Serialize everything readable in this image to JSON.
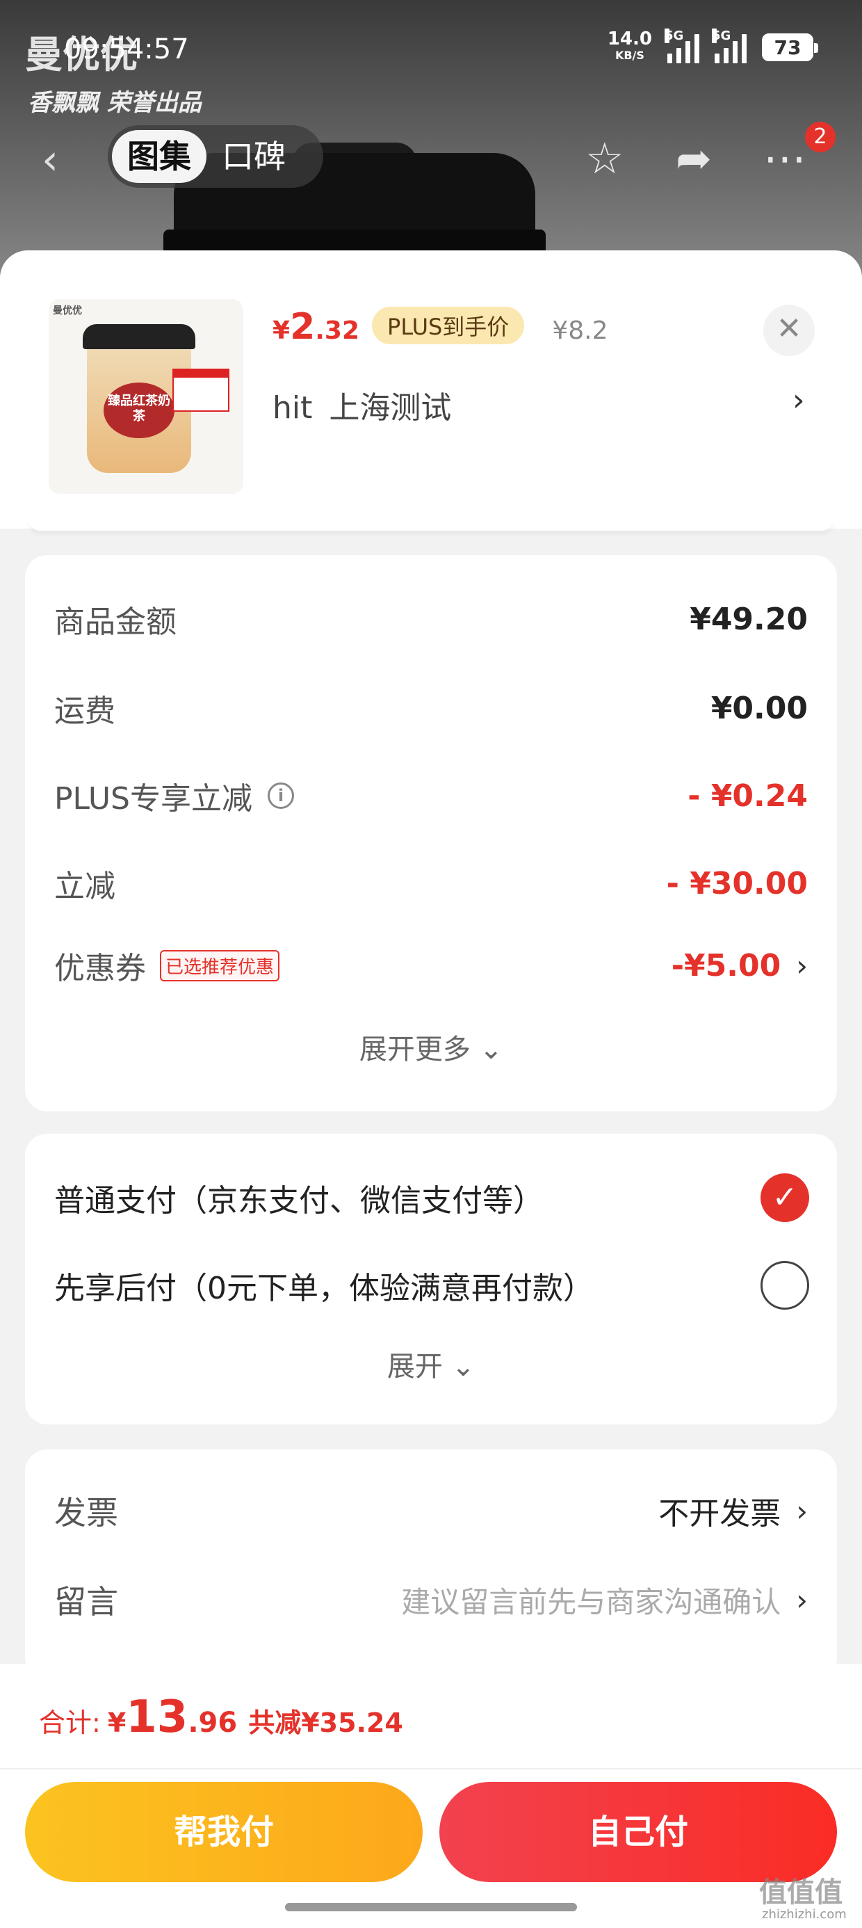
{
  "status_bar": {
    "time": "09:54:57",
    "net_speed": "14.0",
    "net_unit": "KB/S",
    "signal_1": "5G",
    "signal_2": "5G",
    "battery": "73"
  },
  "backdrop": {
    "brand": "曼优优",
    "brand_sub": "香飘飘 荣誉出品"
  },
  "nav": {
    "tabs": [
      "图集",
      "口碑"
    ],
    "active_tab": "图集",
    "badge_count": "2",
    "icons": [
      "back-icon",
      "star-icon",
      "share-icon",
      "more-icon"
    ]
  },
  "product": {
    "thumb_brand": "曼优优",
    "thumb_cup_label": "臻品红茶奶茶",
    "price_symbol": "¥",
    "price_int": "2",
    "price_dec": ".32",
    "plus_tag": "PLUS到手价",
    "original_price": "¥8.2",
    "address_name": "hit",
    "address_city": "上海测试"
  },
  "summary": {
    "rows": [
      {
        "label": "商品金额",
        "value": "¥49.20"
      },
      {
        "label": "运费",
        "value": "¥0.00"
      },
      {
        "label": "PLUS专享立减",
        "value": "- ¥0.24"
      },
      {
        "label": "立减",
        "value": "- ¥30.00"
      },
      {
        "label": "优惠券",
        "tag": "已选推荐优惠",
        "value": "-¥5.00"
      }
    ],
    "expand_more": "展开更多"
  },
  "payment": {
    "options": [
      {
        "label": "普通支付（京东支付、微信支付等）",
        "selected": true
      },
      {
        "label": "先享后付（0元下单，体验满意再付款）",
        "selected": false
      }
    ],
    "expand": "展开"
  },
  "misc": {
    "invoice_label": "发票",
    "invoice_value": "不开发票",
    "note_label": "留言",
    "note_placeholder": "建议留言前先与商家沟通确认"
  },
  "footer": {
    "total_label": "合计:",
    "total_sym": "¥",
    "total_int": "13",
    "total_dec": ".96",
    "total_save": "共减¥35.24",
    "help_pay": "帮我付",
    "self_pay": "自己付",
    "watermark": "值值值",
    "watermark_sub": "zhizhizhi.com"
  },
  "colors": {
    "accent": "#e4322b",
    "help_button": "#fdb61d",
    "plus_tag_bg": "#fbe7b0"
  }
}
